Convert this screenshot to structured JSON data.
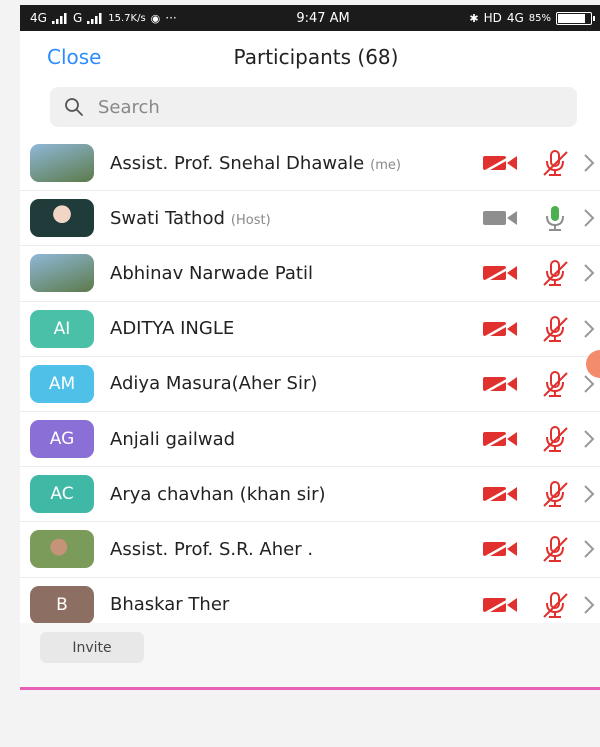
{
  "status_bar": {
    "network_left": "4G",
    "network_mid": "G",
    "speed": "15.7K/s",
    "dots": "···",
    "time": "9:47 AM",
    "hd": "HD",
    "network_right": "4G",
    "battery": "85%",
    "battery_level": 85
  },
  "header": {
    "close_label": "Close",
    "title": "Participants (68)"
  },
  "search": {
    "placeholder": "Search"
  },
  "participants": [
    {
      "name": "Assist. Prof. Snehal Dhawale",
      "tag": "(me)",
      "initials": "",
      "avatar_color": "",
      "video": "off",
      "audio": "muted"
    },
    {
      "name": "Swati Tathod",
      "tag": "(Host)",
      "initials": "",
      "avatar_color": "",
      "video": "off-gray",
      "audio": "on"
    },
    {
      "name": "Abhinav Narwade Patil",
      "tag": "",
      "initials": "",
      "avatar_color": "",
      "video": "off",
      "audio": "muted"
    },
    {
      "name": "ADITYA INGLE",
      "tag": "",
      "initials": "AI",
      "avatar_color": "#4bc0a9",
      "video": "off",
      "audio": "muted"
    },
    {
      "name": "Adiya Masura(Aher Sir)",
      "tag": "",
      "initials": "AM",
      "avatar_color": "#4fc1e8",
      "video": "off",
      "audio": "muted"
    },
    {
      "name": "Anjali gailwad",
      "tag": "",
      "initials": "AG",
      "avatar_color": "#8a6fd6",
      "video": "off",
      "audio": "muted"
    },
    {
      "name": "Arya chavhan (khan sir)",
      "tag": "",
      "initials": "AC",
      "avatar_color": "#3fb8a5",
      "video": "off",
      "audio": "muted"
    },
    {
      "name": "Assist. Prof. S.R. Aher .",
      "tag": "",
      "initials": "",
      "avatar_color": "",
      "video": "off",
      "audio": "muted"
    },
    {
      "name": "Bhaskar Ther",
      "tag": "",
      "initials": "B",
      "avatar_color": "#8d6e63",
      "video": "off",
      "audio": "muted"
    }
  ],
  "footer": {
    "invite_label": "Invite"
  },
  "colors": {
    "accent": "#2d8cff",
    "muted_red": "#e0312e",
    "mic_green": "#4caf50",
    "gray": "#8e8e8e",
    "highlight": "#e85fb7"
  },
  "icons": [
    "search-icon",
    "video-off-icon",
    "mic-muted-icon",
    "mic-icon",
    "chevron-right-icon",
    "signal-icon",
    "battery-icon"
  ]
}
